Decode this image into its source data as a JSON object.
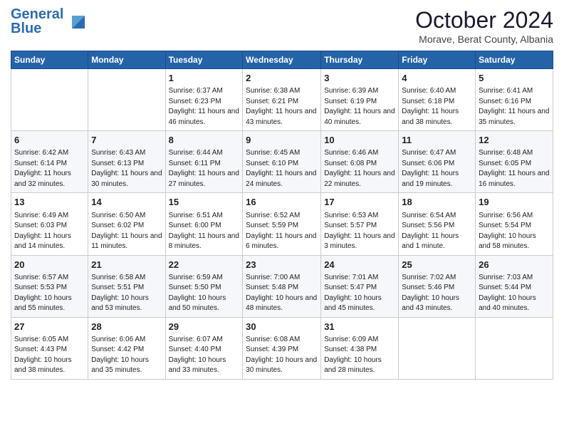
{
  "header": {
    "logo_line1": "General",
    "logo_line2": "Blue",
    "month_title": "October 2024",
    "subtitle": "Morave, Berat County, Albania"
  },
  "weekdays": [
    "Sunday",
    "Monday",
    "Tuesday",
    "Wednesday",
    "Thursday",
    "Friday",
    "Saturday"
  ],
  "weeks": [
    [
      {
        "day": "",
        "sunrise": "",
        "sunset": "",
        "daylight": ""
      },
      {
        "day": "",
        "sunrise": "",
        "sunset": "",
        "daylight": ""
      },
      {
        "day": "1",
        "sunrise": "Sunrise: 6:37 AM",
        "sunset": "Sunset: 6:23 PM",
        "daylight": "Daylight: 11 hours and 46 minutes."
      },
      {
        "day": "2",
        "sunrise": "Sunrise: 6:38 AM",
        "sunset": "Sunset: 6:21 PM",
        "daylight": "Daylight: 11 hours and 43 minutes."
      },
      {
        "day": "3",
        "sunrise": "Sunrise: 6:39 AM",
        "sunset": "Sunset: 6:19 PM",
        "daylight": "Daylight: 11 hours and 40 minutes."
      },
      {
        "day": "4",
        "sunrise": "Sunrise: 6:40 AM",
        "sunset": "Sunset: 6:18 PM",
        "daylight": "Daylight: 11 hours and 38 minutes."
      },
      {
        "day": "5",
        "sunrise": "Sunrise: 6:41 AM",
        "sunset": "Sunset: 6:16 PM",
        "daylight": "Daylight: 11 hours and 35 minutes."
      }
    ],
    [
      {
        "day": "6",
        "sunrise": "Sunrise: 6:42 AM",
        "sunset": "Sunset: 6:14 PM",
        "daylight": "Daylight: 11 hours and 32 minutes."
      },
      {
        "day": "7",
        "sunrise": "Sunrise: 6:43 AM",
        "sunset": "Sunset: 6:13 PM",
        "daylight": "Daylight: 11 hours and 30 minutes."
      },
      {
        "day": "8",
        "sunrise": "Sunrise: 6:44 AM",
        "sunset": "Sunset: 6:11 PM",
        "daylight": "Daylight: 11 hours and 27 minutes."
      },
      {
        "day": "9",
        "sunrise": "Sunrise: 6:45 AM",
        "sunset": "Sunset: 6:10 PM",
        "daylight": "Daylight: 11 hours and 24 minutes."
      },
      {
        "day": "10",
        "sunrise": "Sunrise: 6:46 AM",
        "sunset": "Sunset: 6:08 PM",
        "daylight": "Daylight: 11 hours and 22 minutes."
      },
      {
        "day": "11",
        "sunrise": "Sunrise: 6:47 AM",
        "sunset": "Sunset: 6:06 PM",
        "daylight": "Daylight: 11 hours and 19 minutes."
      },
      {
        "day": "12",
        "sunrise": "Sunrise: 6:48 AM",
        "sunset": "Sunset: 6:05 PM",
        "daylight": "Daylight: 11 hours and 16 minutes."
      }
    ],
    [
      {
        "day": "13",
        "sunrise": "Sunrise: 6:49 AM",
        "sunset": "Sunset: 6:03 PM",
        "daylight": "Daylight: 11 hours and 14 minutes."
      },
      {
        "day": "14",
        "sunrise": "Sunrise: 6:50 AM",
        "sunset": "Sunset: 6:02 PM",
        "daylight": "Daylight: 11 hours and 11 minutes."
      },
      {
        "day": "15",
        "sunrise": "Sunrise: 6:51 AM",
        "sunset": "Sunset: 6:00 PM",
        "daylight": "Daylight: 11 hours and 8 minutes."
      },
      {
        "day": "16",
        "sunrise": "Sunrise: 6:52 AM",
        "sunset": "Sunset: 5:59 PM",
        "daylight": "Daylight: 11 hours and 6 minutes."
      },
      {
        "day": "17",
        "sunrise": "Sunrise: 6:53 AM",
        "sunset": "Sunset: 5:57 PM",
        "daylight": "Daylight: 11 hours and 3 minutes."
      },
      {
        "day": "18",
        "sunrise": "Sunrise: 6:54 AM",
        "sunset": "Sunset: 5:56 PM",
        "daylight": "Daylight: 11 hours and 1 minute."
      },
      {
        "day": "19",
        "sunrise": "Sunrise: 6:56 AM",
        "sunset": "Sunset: 5:54 PM",
        "daylight": "Daylight: 10 hours and 58 minutes."
      }
    ],
    [
      {
        "day": "20",
        "sunrise": "Sunrise: 6:57 AM",
        "sunset": "Sunset: 5:53 PM",
        "daylight": "Daylight: 10 hours and 55 minutes."
      },
      {
        "day": "21",
        "sunrise": "Sunrise: 6:58 AM",
        "sunset": "Sunset: 5:51 PM",
        "daylight": "Daylight: 10 hours and 53 minutes."
      },
      {
        "day": "22",
        "sunrise": "Sunrise: 6:59 AM",
        "sunset": "Sunset: 5:50 PM",
        "daylight": "Daylight: 10 hours and 50 minutes."
      },
      {
        "day": "23",
        "sunrise": "Sunrise: 7:00 AM",
        "sunset": "Sunset: 5:48 PM",
        "daylight": "Daylight: 10 hours and 48 minutes."
      },
      {
        "day": "24",
        "sunrise": "Sunrise: 7:01 AM",
        "sunset": "Sunset: 5:47 PM",
        "daylight": "Daylight: 10 hours and 45 minutes."
      },
      {
        "day": "25",
        "sunrise": "Sunrise: 7:02 AM",
        "sunset": "Sunset: 5:46 PM",
        "daylight": "Daylight: 10 hours and 43 minutes."
      },
      {
        "day": "26",
        "sunrise": "Sunrise: 7:03 AM",
        "sunset": "Sunset: 5:44 PM",
        "daylight": "Daylight: 10 hours and 40 minutes."
      }
    ],
    [
      {
        "day": "27",
        "sunrise": "Sunrise: 6:05 AM",
        "sunset": "Sunset: 4:43 PM",
        "daylight": "Daylight: 10 hours and 38 minutes."
      },
      {
        "day": "28",
        "sunrise": "Sunrise: 6:06 AM",
        "sunset": "Sunset: 4:42 PM",
        "daylight": "Daylight: 10 hours and 35 minutes."
      },
      {
        "day": "29",
        "sunrise": "Sunrise: 6:07 AM",
        "sunset": "Sunset: 4:40 PM",
        "daylight": "Daylight: 10 hours and 33 minutes."
      },
      {
        "day": "30",
        "sunrise": "Sunrise: 6:08 AM",
        "sunset": "Sunset: 4:39 PM",
        "daylight": "Daylight: 10 hours and 30 minutes."
      },
      {
        "day": "31",
        "sunrise": "Sunrise: 6:09 AM",
        "sunset": "Sunset: 4:38 PM",
        "daylight": "Daylight: 10 hours and 28 minutes."
      },
      {
        "day": "",
        "sunrise": "",
        "sunset": "",
        "daylight": ""
      },
      {
        "day": "",
        "sunrise": "",
        "sunset": "",
        "daylight": ""
      }
    ]
  ]
}
